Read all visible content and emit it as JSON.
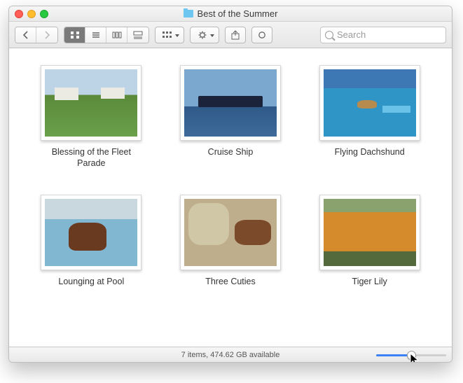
{
  "window": {
    "title": "Best of the Summer"
  },
  "search": {
    "placeholder": "Search"
  },
  "items": [
    {
      "name": "Blessing of the Fleet Parade"
    },
    {
      "name": "Cruise Ship"
    },
    {
      "name": "Flying Dachshund"
    },
    {
      "name": "Lounging at Pool"
    },
    {
      "name": "Three Cuties"
    },
    {
      "name": "Tiger Lily"
    }
  ],
  "status": {
    "text": "7 items, 474.62 GB available"
  }
}
